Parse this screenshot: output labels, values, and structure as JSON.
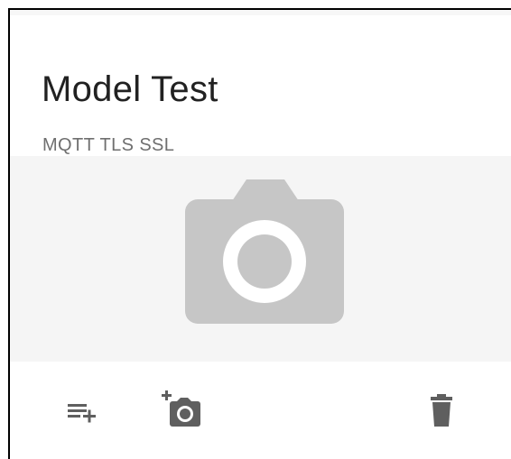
{
  "card": {
    "title": "Model Test",
    "subtitle": "MQTT TLS SSL",
    "media_icon": "camera-icon"
  },
  "actions": {
    "add_list": "playlist-add-icon",
    "add_photo": "add-a-photo-icon",
    "delete": "delete-icon"
  },
  "colors": {
    "title": "#212121",
    "subtitle": "#6f6f6f",
    "media_background": "#f5f5f5",
    "placeholder_icon": "#c6c6c6",
    "action_icon": "#5f5f5f"
  }
}
